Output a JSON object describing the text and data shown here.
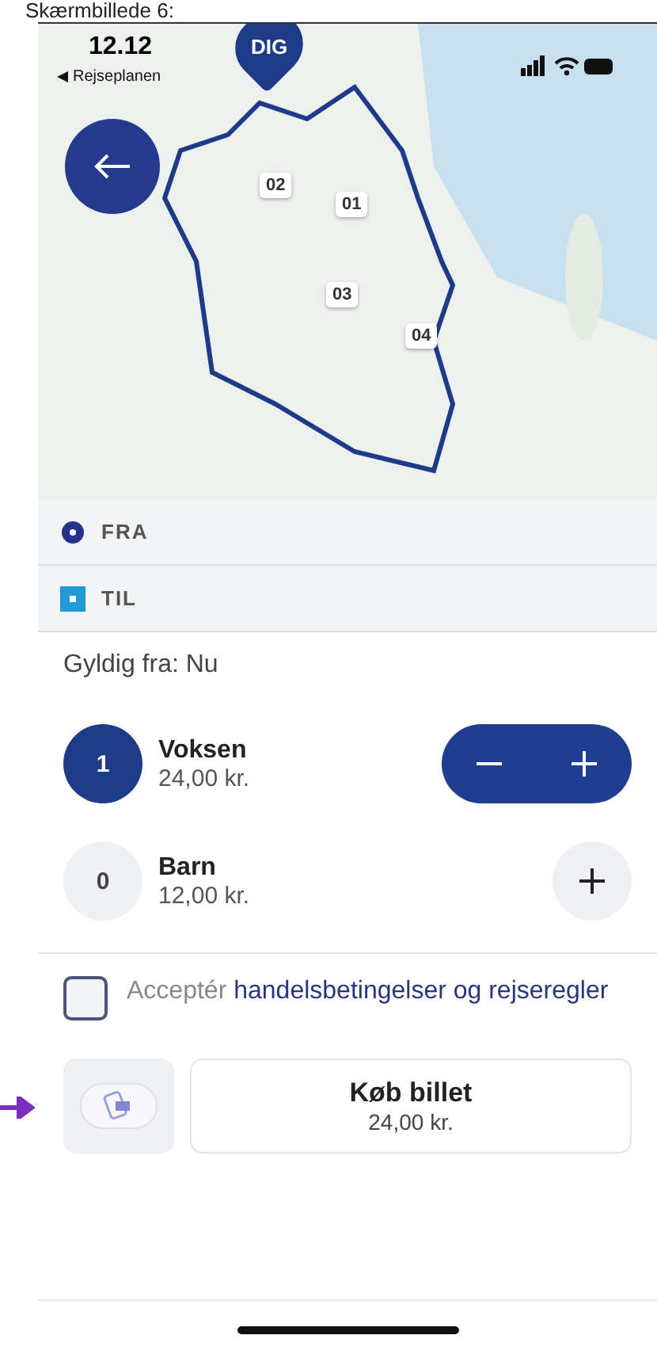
{
  "document": {
    "caption": "Skærmbillede 6:"
  },
  "status_bar": {
    "time": "12.12",
    "back_app": "Rejseplanen"
  },
  "map": {
    "pin_label": "DIG",
    "zones": [
      {
        "label": "02"
      },
      {
        "label": "01"
      },
      {
        "label": "03"
      },
      {
        "label": "04"
      }
    ]
  },
  "route": [
    {
      "kind": "from",
      "label": "FRA"
    },
    {
      "kind": "to",
      "label": "TIL"
    }
  ],
  "valid_from": "Gyldig fra: Nu",
  "passengers": [
    {
      "count": "1",
      "name": "Voksen",
      "price": "24,00 kr.",
      "selected": true
    },
    {
      "count": "0",
      "name": "Barn",
      "price": "12,00 kr.",
      "selected": false
    }
  ],
  "terms": {
    "checked": false,
    "text": "Acceptér",
    "link": "handelsbetingelser og rejseregler"
  },
  "buy_button": {
    "label": "Køb billet",
    "price": "24,00 kr."
  }
}
